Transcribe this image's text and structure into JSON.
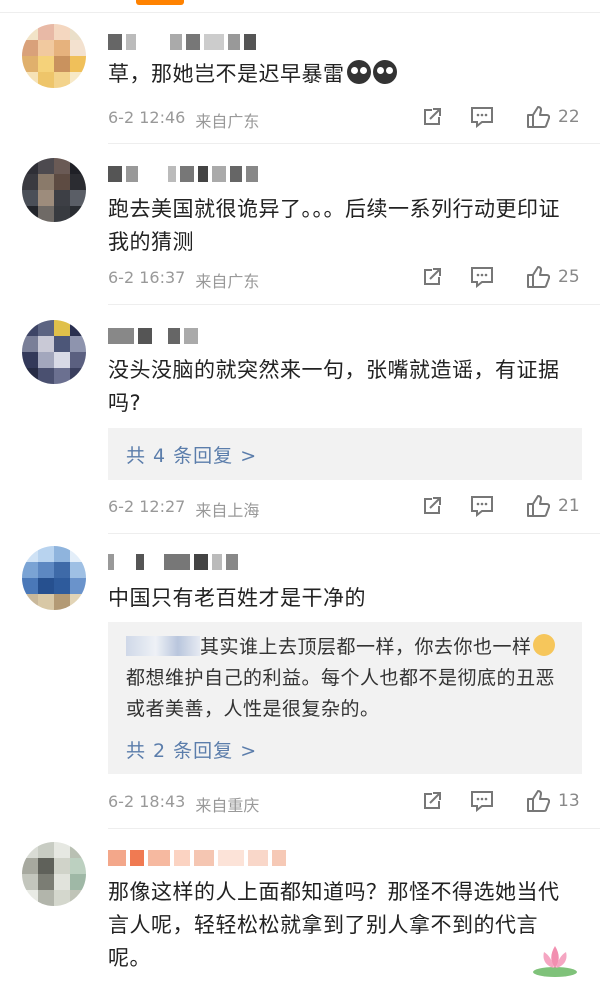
{
  "comments": [
    {
      "text": "草，那她岂不是迟早暴雷",
      "time": "6-2 12:46",
      "location": "来自广东",
      "likes": "22",
      "emoji": "crying-face-emoji"
    },
    {
      "text": "跑去美国就很诡异了。。。后续一系列行动更印证我的猜测",
      "time": "6-2 16:37",
      "location": "来自广东",
      "likes": "25"
    },
    {
      "text": "没头没脑的就突然来一句，张嘴就造谣，有证据吗?",
      "time": "6-2 12:27",
      "location": "来自上海",
      "likes": "21",
      "reply_more": "共 4 条回复 >"
    },
    {
      "text": "中国只有老百姓才是干净的",
      "time": "6-2 18:43",
      "location": "来自重庆",
      "likes": "13",
      "reply_preview_a": "其实谁上去顶层都一样，你去你也一样",
      "reply_preview_b": "都想维护自己的利益。每个人也都不是彻底的丑恶或者美善，人性是很复杂的。",
      "reply_more": "共 2 条回复 >"
    },
    {
      "text": "那像这样的人上面都知道吗？那怪不得选她当代言人呢，轻轻松松就拿到了别人拿不到的代言呢。"
    }
  ],
  "colors": {
    "accent": "#ff8200",
    "link": "#5b7dab",
    "meta": "#999999",
    "reply_bg": "#f2f2f2"
  },
  "icons": [
    "share-icon",
    "comment-icon",
    "like-icon",
    "lotus-sticker-icon"
  ]
}
